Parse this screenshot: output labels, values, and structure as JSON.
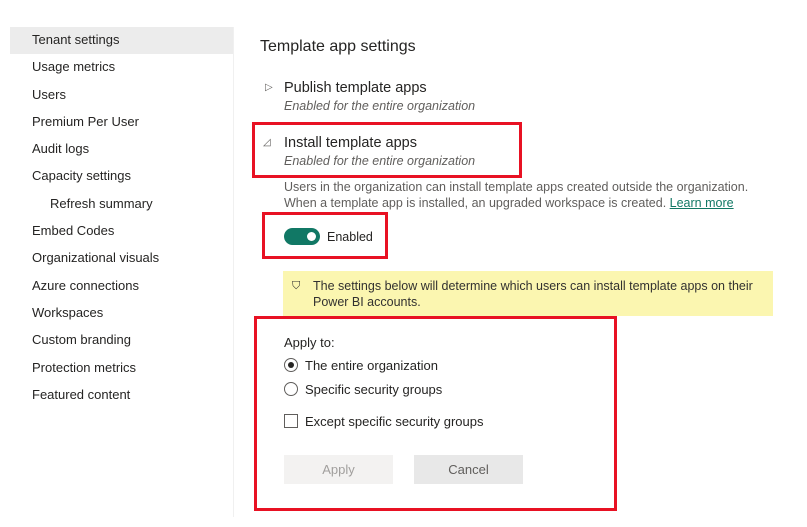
{
  "sidebar": {
    "items": [
      {
        "label": "Tenant settings",
        "selected": true
      },
      {
        "label": "Usage metrics"
      },
      {
        "label": "Users"
      },
      {
        "label": "Premium Per User"
      },
      {
        "label": "Audit logs"
      },
      {
        "label": "Capacity settings"
      },
      {
        "label": "Refresh summary",
        "sub": true
      },
      {
        "label": "Embed Codes"
      },
      {
        "label": "Organizational visuals"
      },
      {
        "label": "Azure connections"
      },
      {
        "label": "Workspaces"
      },
      {
        "label": "Custom branding"
      },
      {
        "label": "Protection metrics"
      },
      {
        "label": "Featured content"
      }
    ]
  },
  "main": {
    "heading": "Template app settings",
    "publish": {
      "title": "Publish template apps",
      "status": "Enabled for the entire organization",
      "expanded": false
    },
    "install": {
      "title": "Install template apps",
      "status": "Enabled for the entire organization",
      "expanded": true,
      "description": "Users in the organization can install template apps created outside the organization. When a template app is installed, an upgraded workspace is created.",
      "learn_more": "Learn more",
      "toggle_label": "Enabled",
      "toggle_on": true,
      "warning": "The settings below will determine which users can install template apps on their Power BI accounts.",
      "apply_to_label": "Apply to:",
      "options": [
        {
          "label": "The entire organization",
          "selected": true
        },
        {
          "label": "Specific security groups",
          "selected": false
        }
      ],
      "except_label": "Except specific security groups",
      "except_checked": false,
      "apply_button": "Apply",
      "cancel_button": "Cancel"
    }
  },
  "colors": {
    "accent": "#117865",
    "highlight": "#e81123",
    "warning_bg": "#fbf6b0"
  }
}
